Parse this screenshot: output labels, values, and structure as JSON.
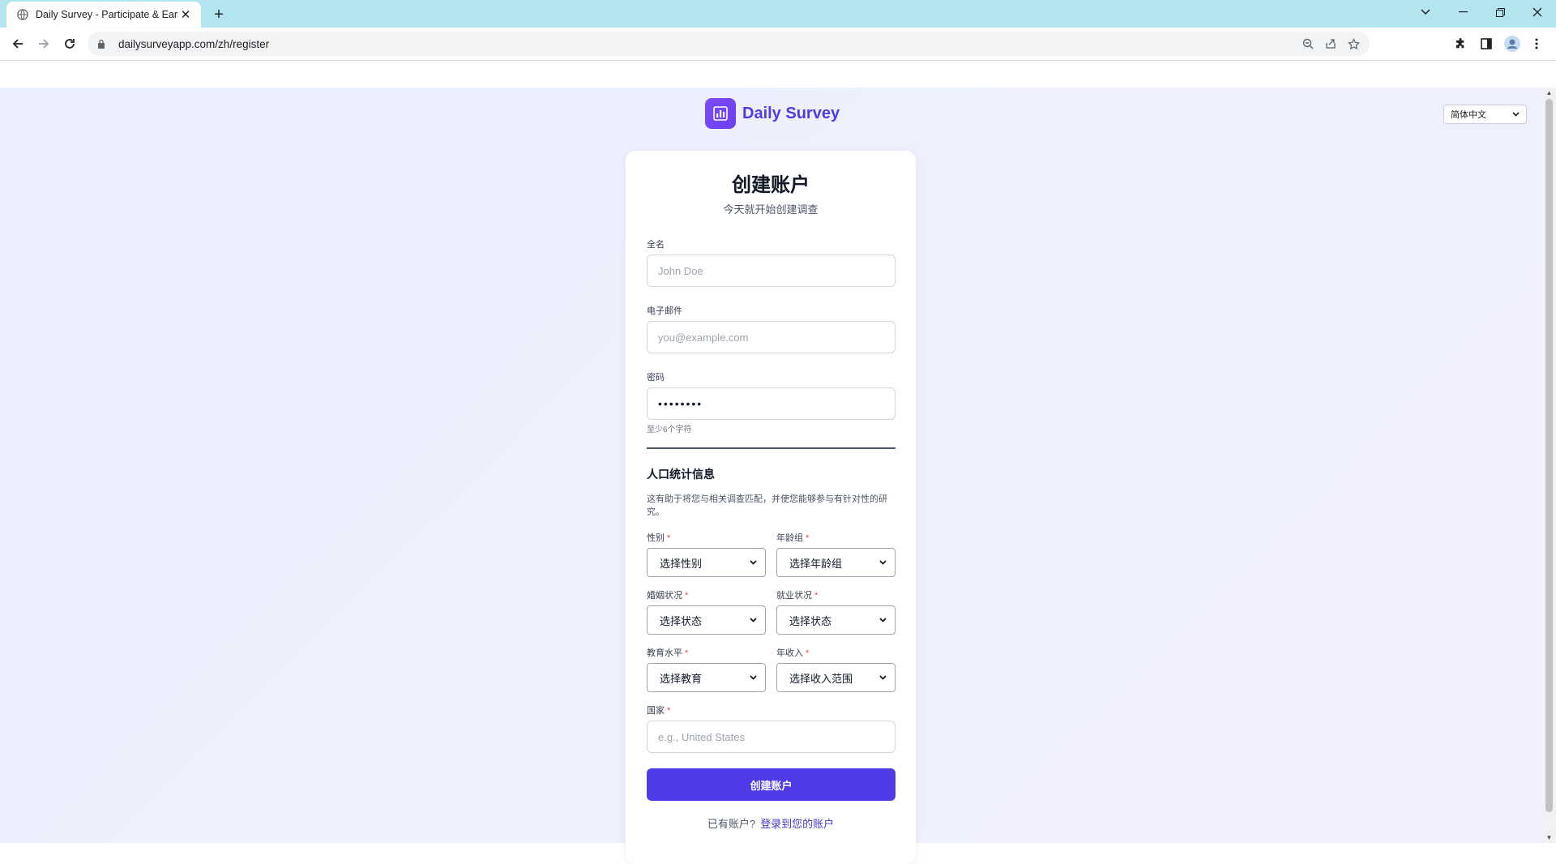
{
  "browser": {
    "tab_title": "Daily Survey - Participate & Earn",
    "url": "dailysurveyapp.com/zh/register"
  },
  "page": {
    "language_selector": "简体中文",
    "brand_name": "Daily Survey",
    "title": "创建账户",
    "subtitle": "今天就开始创建调查",
    "full_name": {
      "label": "全名",
      "placeholder": "John Doe"
    },
    "email": {
      "label": "电子邮件",
      "placeholder": "you@example.com"
    },
    "password": {
      "label": "密码",
      "value": "••••••••",
      "hint": "至少6个字符"
    },
    "demographics": {
      "title": "人口统计信息",
      "description": "这有助于将您与相关调查匹配，并使您能够参与有针对性的研究。",
      "gender": {
        "label": "性别",
        "selected": "选择性别"
      },
      "age_group": {
        "label": "年龄组",
        "selected": "选择年龄组"
      },
      "marital_status": {
        "label": "婚姻状况",
        "selected": "选择状态"
      },
      "employment_status": {
        "label": "就业状况",
        "selected": "选择状态"
      },
      "education": {
        "label": "教育水平",
        "selected": "选择教育"
      },
      "income": {
        "label": "年收入",
        "selected": "选择收入范围"
      },
      "country": {
        "label": "国家",
        "placeholder": "e.g., United States"
      }
    },
    "required_mark": "*",
    "submit_label": "创建账户",
    "signin_prompt": "已有账户?",
    "signin_link": "登录到您的账户"
  },
  "colors": {
    "accent": "#4f3ae8",
    "brand": "#4f3ce6",
    "tabstrip": "#b3e5ef"
  }
}
